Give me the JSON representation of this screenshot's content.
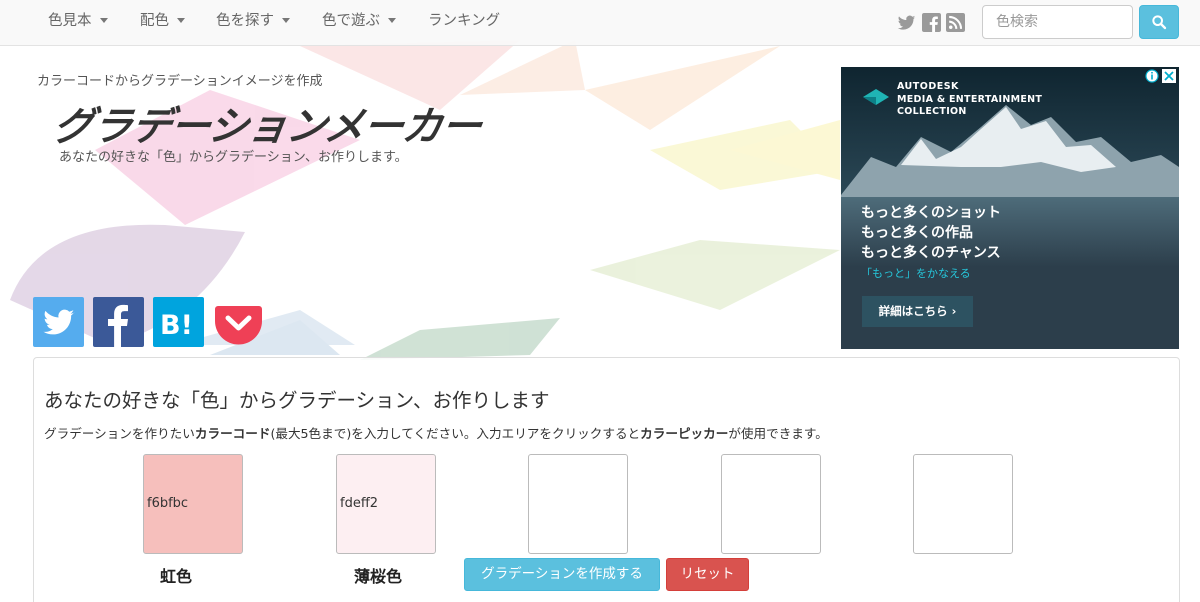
{
  "nav": {
    "items": [
      {
        "label": "色見本",
        "caret": true
      },
      {
        "label": "配色",
        "caret": true
      },
      {
        "label": "色を探す",
        "caret": true
      },
      {
        "label": "色で遊ぶ",
        "caret": true
      },
      {
        "label": "ランキング",
        "caret": false
      }
    ],
    "social_icons": [
      "twitter-icon",
      "facebook-icon",
      "rss-icon"
    ],
    "search": {
      "placeholder": "色検索",
      "value": ""
    },
    "search_button_icon": "search-icon"
  },
  "header": {
    "kicker": "カラーコードからグラデーションイメージを作成",
    "logo": "グラデーションメーカー",
    "subcopy": "あなたの好きな「色」からグラデーション、お作りします。"
  },
  "share_buttons": [
    "twitter-icon",
    "facebook-icon",
    "hatena-bookmark-icon",
    "pocket-icon"
  ],
  "ad": {
    "brand_line1": "AUTODESK",
    "brand_line2": "MEDIA & ENTERTAINMENT",
    "brand_line3": "COLLECTION",
    "lines": [
      "もっと多くのショット",
      "もっと多くの作品",
      "もっと多くのチャンス"
    ],
    "tagline": "「もっと」をかなえる",
    "cta": "詳細はこちら ›"
  },
  "panel": {
    "title": "あなたの好きな「色」からグラデーション、お作りします",
    "desc_before": "グラデーションを作りたい",
    "desc_bold1": "カラーコード",
    "desc_middle": "(最大5色まで)を入力してください。入力エリアをクリックすると",
    "desc_bold2": "カラーピッカー",
    "desc_after": "が使用できます。",
    "swatches": [
      {
        "code": "f6bfbc",
        "color": "#f6bfbc",
        "name": "虹色"
      },
      {
        "code": "fdeff2",
        "color": "#fdeff2",
        "name": "薄桜色"
      },
      {
        "code": "",
        "color": "#ffffff",
        "name": ""
      },
      {
        "code": "",
        "color": "#ffffff",
        "name": ""
      },
      {
        "code": "",
        "color": "#ffffff",
        "name": ""
      }
    ],
    "create_button": "グラデーションを作成する",
    "reset_button": "リセット"
  },
  "colors": {
    "twitter": "#55acee",
    "facebook": "#3b5998",
    "hatena": "#00a4de",
    "pocket": "#ef4056",
    "info_button": "#5bc0de",
    "danger_button": "#d9534f"
  }
}
